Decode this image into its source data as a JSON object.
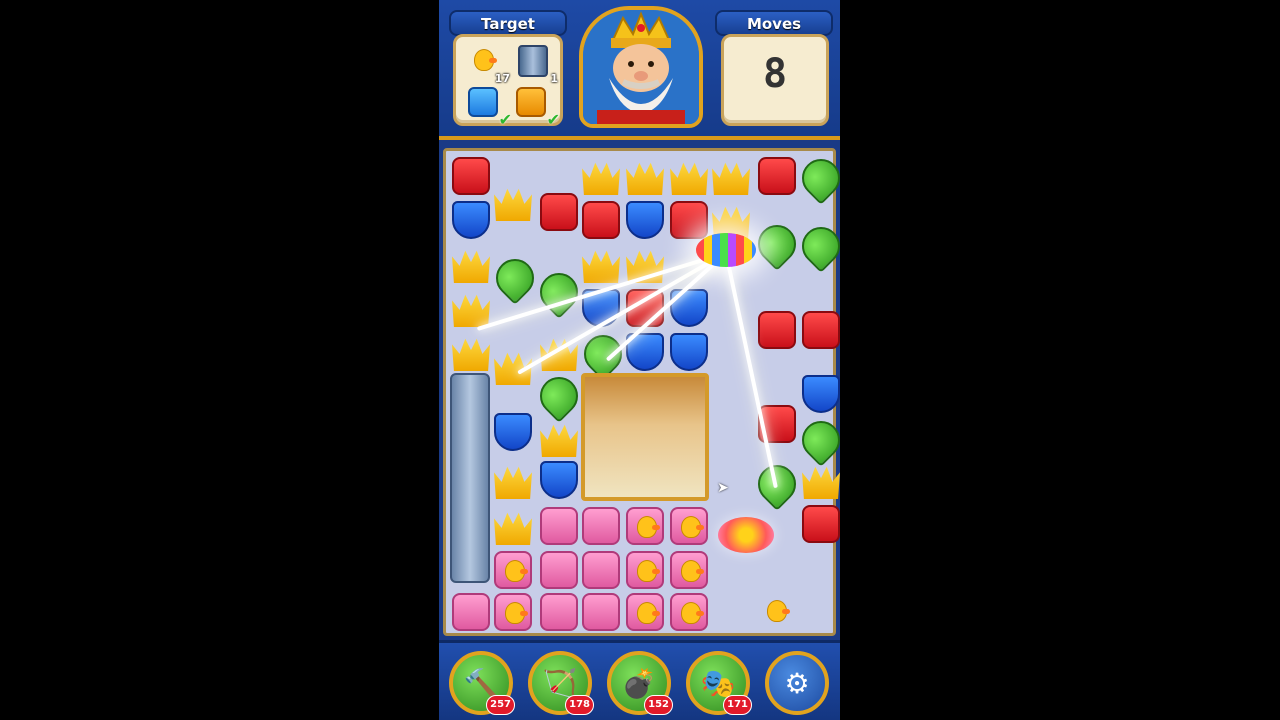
{
  "header": {
    "target_label": "Target",
    "moves_label": "Moves",
    "moves_value": "8",
    "goals": [
      {
        "icon": "duck-icon",
        "count": "17",
        "complete": false
      },
      {
        "icon": "pipe-icon",
        "count": "1",
        "complete": false
      },
      {
        "icon": "blue-tile-icon",
        "count": "",
        "complete": true
      },
      {
        "icon": "orange-tile-icon",
        "count": "",
        "complete": true
      }
    ]
  },
  "boosters": [
    {
      "name": "hammer-icon",
      "count": "257"
    },
    {
      "name": "arrow-icon",
      "count": "178"
    },
    {
      "name": "cannon-icon",
      "count": "152"
    },
    {
      "name": "jester-hat-icon",
      "count": "171"
    }
  ],
  "colors": {
    "red": "#e21a2a",
    "blue": "#1d5ad8",
    "green": "#3fb82e",
    "yellow": "#f5c21a",
    "pink": "#ff8ec8",
    "frame": "#1a3a86",
    "gold": "#e1a31f"
  }
}
